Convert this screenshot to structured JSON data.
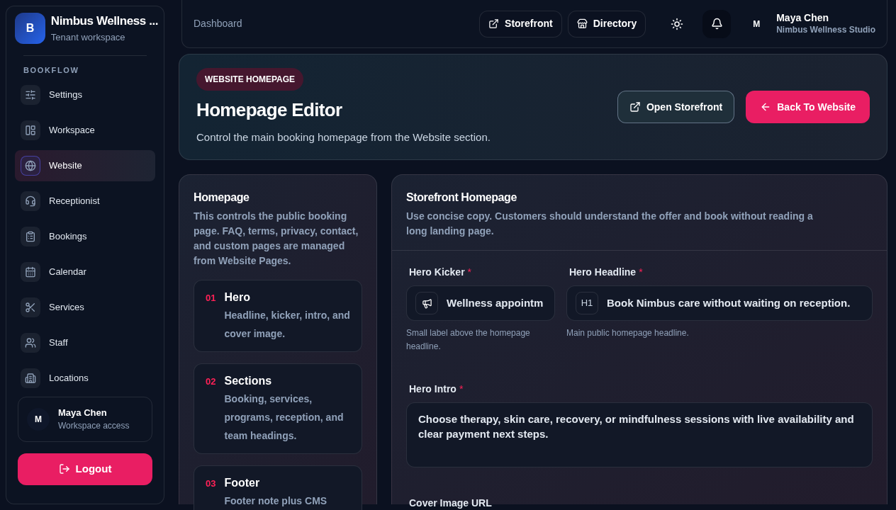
{
  "brand": {
    "initial": "B",
    "name": "Nimbus Wellness ...",
    "subtitle": "Tenant workspace"
  },
  "sidebar": {
    "section": "BOOKFLOW",
    "items": [
      {
        "label": "Settings",
        "selected": false
      },
      {
        "label": "Workspace",
        "selected": false
      },
      {
        "label": "Website",
        "selected": true
      },
      {
        "label": "Receptionist",
        "selected": false
      },
      {
        "label": "Bookings",
        "selected": false
      },
      {
        "label": "Calendar",
        "selected": false
      },
      {
        "label": "Services",
        "selected": false
      },
      {
        "label": "Staff",
        "selected": false
      },
      {
        "label": "Locations",
        "selected": false
      }
    ],
    "user": {
      "initial": "M",
      "name": "Maya Chen",
      "role": "Workspace access"
    },
    "logout": "Logout"
  },
  "topbar": {
    "breadcrumb": "Dashboard",
    "links": [
      {
        "label": "Storefront"
      },
      {
        "label": "Directory"
      }
    ],
    "user": {
      "initial": "M",
      "name": "Maya Chen",
      "org": "Nimbus Wellness Studio"
    }
  },
  "hero": {
    "badge": "WEBSITE HOMEPAGE",
    "title": "Homepage Editor",
    "subtitle": "Control the main booking homepage from the Website section.",
    "secondary_button": "Open Storefront",
    "primary_button": "Back To Website"
  },
  "steps_panel": {
    "title": "Homepage",
    "description": "This controls the public booking page. FAQ, terms, privacy, contact, and custom pages are managed from Website Pages.",
    "steps": [
      {
        "number": "01",
        "title": "Hero",
        "description": "Headline, kicker, intro, and cover image."
      },
      {
        "number": "02",
        "title": "Sections",
        "description": "Booking, services, programs, reception, and team headings."
      },
      {
        "number": "03",
        "title": "Footer",
        "description": "Footer note plus CMS"
      }
    ]
  },
  "form": {
    "title": "Storefront Homepage",
    "description": "Use concise copy. Customers should understand the offer and book without reading a long landing page.",
    "kicker": {
      "label": "Hero Kicker",
      "required_mark": "*",
      "value": "Wellness appointm",
      "hint": "Small label above the homepage headline."
    },
    "headline": {
      "label": "Hero Headline",
      "required_mark": "*",
      "prefix": "H1",
      "value": "Book Nimbus care without waiting on reception.",
      "hint": "Main public homepage headline."
    },
    "intro": {
      "label": "Hero Intro",
      "required_mark": "*",
      "value": "Choose therapy, skin care, recovery, or mindfulness sessions with live availability and clear payment next steps."
    },
    "cover": {
      "label": "Cover Image URL"
    }
  }
}
